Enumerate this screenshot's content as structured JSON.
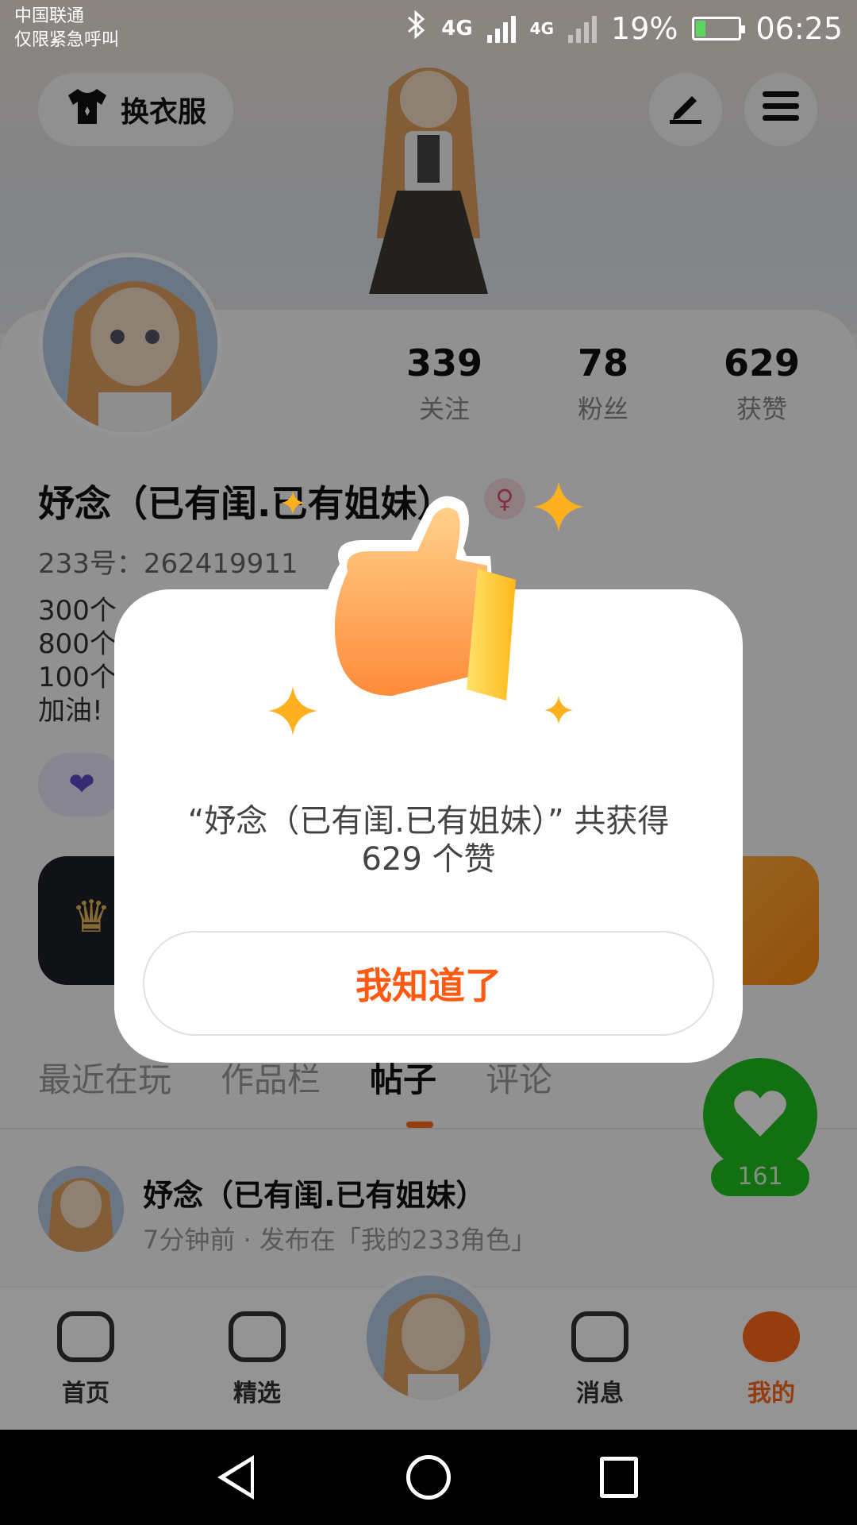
{
  "status_bar": {
    "carrier_line1": "中国联通",
    "carrier_line2": "仅限紧急呼叫",
    "network_1": "4G",
    "network_2": "4G",
    "battery": "19%",
    "time": "06:25",
    "bluetooth_icon": "bluetooth-icon"
  },
  "header": {
    "outfit_label": "换衣服",
    "edit_icon": "edit-icon",
    "menu_icon": "menu-icon"
  },
  "profile": {
    "stats": [
      {
        "value": "339",
        "label": "关注"
      },
      {
        "value": "78",
        "label": "粉丝"
      },
      {
        "value": "629",
        "label": "获赞"
      }
    ],
    "name": "妤念（已有闺.已有姐妹）",
    "gender_icon": "♀",
    "uid": "233号：262419911",
    "bio_lines": [
      "300个",
      "800个",
      "100个",
      "加油!"
    ]
  },
  "tabs": [
    "最近在玩",
    "作品栏",
    "帖子",
    "评论"
  ],
  "active_tab": "帖子",
  "post": {
    "author": "妤念（已有闺.已有姐妹）",
    "meta": "7分钟前 · 发布在「我的233角色」"
  },
  "like_fab": {
    "count": "161"
  },
  "bottom_nav": [
    {
      "label": "首页"
    },
    {
      "label": "精选"
    },
    {
      "label": "消息"
    },
    {
      "label": "我的"
    }
  ],
  "modal": {
    "message_line1": "“妤念（已有闺.已有姐妹）” 共获得",
    "message_line2": "629 个赞",
    "ok_button": "我知道了"
  },
  "colors": {
    "accent": "#ff5a14",
    "like_green": "#1fbf1f",
    "sparkle": "#ffb01e"
  }
}
